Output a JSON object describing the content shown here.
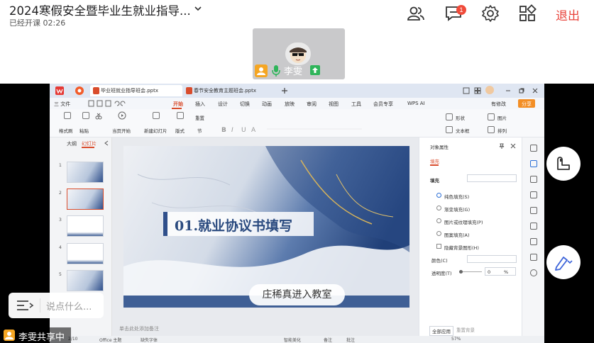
{
  "meeting": {
    "title": "2024寒假安全暨毕业生就业指导...",
    "status": "已经开课 02:26",
    "exit_label": "退出",
    "chat_badge": "1"
  },
  "participant": {
    "name": "李雯"
  },
  "wps": {
    "tabs": [
      "毕业班就业指导班会.pptx",
      "春节安全教育主题班会.pptx"
    ],
    "menu": [
      "三 文件",
      "开始",
      "插入",
      "设计",
      "切换",
      "动画",
      "放映",
      "审阅",
      "视图",
      "工具",
      "会员专享",
      "WPS AI"
    ],
    "active_menu": "开始",
    "menu_right": [
      "有修改",
      "分享"
    ],
    "ribbon": {
      "format_painter": "格式刷",
      "paste": "粘贴",
      "play_from_current": "当页开始",
      "new_slide": "新建幻灯片",
      "layout": "版式",
      "section": "节",
      "reset": "重置",
      "shape": "形状",
      "picture": "图片",
      "textbox": "文本框",
      "arrange": "排列"
    },
    "left_tabs": [
      "大纲",
      "幻灯片"
    ],
    "active_left_tab": "幻灯片",
    "slide_numbers": [
      "1",
      "2",
      "3",
      "4",
      "5"
    ],
    "slide": {
      "title": "01.就业协议书填写"
    },
    "notes_placeholder": "单击此处添加备注",
    "status_items": [
      "2/10",
      "Office 主题",
      "缺失字体",
      "智能美化",
      "备注",
      "批注",
      "57%"
    ],
    "panel": {
      "title": "对象属性",
      "tab": "填充",
      "section": "填充",
      "options": [
        "纯色填充(S)",
        "渐变填充(G)",
        "图片或纹理填充(P)",
        "图案填充(A)"
      ],
      "hide_bg": "隐藏背景图形(H)",
      "color_label": "颜色(C)",
      "transparency_label": "透明度(T)",
      "transparency_value": "0",
      "transparency_unit": "%",
      "apply_all": "全部应用",
      "reset_bg": "重置背景"
    }
  },
  "overlay": {
    "entrance_notice": "庄稀真进入教室",
    "chat_placeholder": "说点什么...",
    "sharer_label": "李雯共享中"
  }
}
